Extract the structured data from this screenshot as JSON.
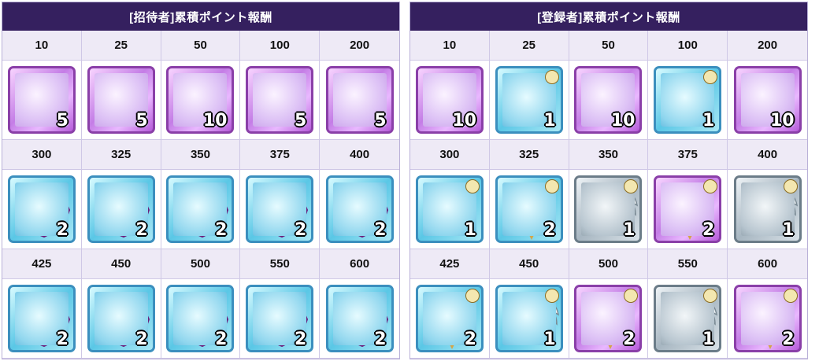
{
  "left": {
    "title": "[招待者]累積ポイント報酬",
    "rows": [
      {
        "points": [
          "10",
          "25",
          "50",
          "100",
          "200"
        ],
        "items": [
          {
            "icon": "gem-icon",
            "frame": "purple",
            "qty": "5"
          },
          {
            "icon": "gem-icon",
            "frame": "purple",
            "qty": "5"
          },
          {
            "icon": "gem-icon",
            "frame": "purple",
            "qty": "10"
          },
          {
            "icon": "gem-icon",
            "frame": "purple",
            "qty": "5"
          },
          {
            "icon": "gem-icon",
            "frame": "purple",
            "qty": "5"
          }
        ]
      },
      {
        "points": [
          "300",
          "325",
          "350",
          "375",
          "400"
        ],
        "items": [
          {
            "icon": "orb-icon",
            "frame": "cyan",
            "qty": "2"
          },
          {
            "icon": "orb-icon",
            "frame": "cyan",
            "qty": "2"
          },
          {
            "icon": "orb-icon",
            "frame": "cyan",
            "qty": "2"
          },
          {
            "icon": "orb-icon",
            "frame": "cyan",
            "qty": "2"
          },
          {
            "icon": "orb-icon",
            "frame": "cyan",
            "qty": "2"
          }
        ]
      },
      {
        "points": [
          "425",
          "450",
          "500",
          "550",
          "600"
        ],
        "items": [
          {
            "icon": "orb-icon",
            "frame": "cyan",
            "qty": "2"
          },
          {
            "icon": "orb-icon",
            "frame": "cyan",
            "qty": "2"
          },
          {
            "icon": "orb-icon",
            "frame": "cyan",
            "qty": "2"
          },
          {
            "icon": "orb-icon",
            "frame": "cyan",
            "qty": "2"
          },
          {
            "icon": "orb-icon",
            "frame": "cyan",
            "qty": "2"
          }
        ]
      }
    ]
  },
  "right": {
    "title": "[登録者]累積ポイント報酬",
    "rows": [
      {
        "points": [
          "10",
          "25",
          "50",
          "100",
          "200"
        ],
        "items": [
          {
            "icon": "gem-icon",
            "frame": "purple",
            "qty": "10"
          },
          {
            "icon": "chest-icon",
            "frame": "cyan",
            "qty": "1",
            "badge": true
          },
          {
            "icon": "gem-icon",
            "frame": "purple",
            "qty": "10"
          },
          {
            "icon": "chest-icon",
            "frame": "cyan",
            "qty": "1",
            "badge": true
          },
          {
            "icon": "gem-icon",
            "frame": "purple",
            "qty": "10"
          }
        ]
      },
      {
        "points": [
          "300",
          "325",
          "350",
          "375",
          "400"
        ],
        "items": [
          {
            "icon": "chest-icon",
            "frame": "cyan",
            "qty": "1",
            "badge": true
          },
          {
            "icon": "mirror-icon",
            "frame": "cyan",
            "qty": "2",
            "badge": true
          },
          {
            "icon": "star-icon",
            "frame": "gray",
            "qty": "1",
            "badge": true
          },
          {
            "icon": "mirror-icon",
            "frame": "purple",
            "qty": "2",
            "badge": true
          },
          {
            "icon": "star-icon",
            "frame": "gray",
            "qty": "1",
            "badge": true
          }
        ]
      },
      {
        "points": [
          "425",
          "450",
          "500",
          "550",
          "600"
        ],
        "items": [
          {
            "icon": "mirror-icon",
            "frame": "cyan",
            "qty": "2",
            "badge": true
          },
          {
            "icon": "star-icon",
            "frame": "cyan",
            "qty": "1",
            "badge": true
          },
          {
            "icon": "mirror-icon",
            "frame": "purple",
            "qty": "2",
            "badge": true
          },
          {
            "icon": "star-icon",
            "frame": "gray",
            "qty": "1",
            "badge": true
          },
          {
            "icon": "mirror-icon",
            "frame": "purple",
            "qty": "2",
            "badge": true
          }
        ]
      }
    ]
  }
}
